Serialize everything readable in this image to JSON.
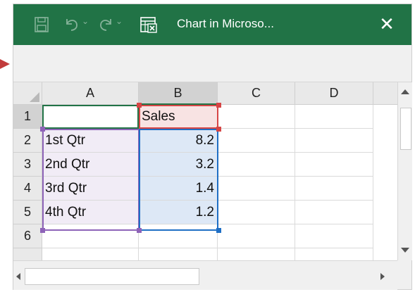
{
  "titlebar": {
    "title": "Chart in Microso...",
    "close_glyph": "✕",
    "undo_dropdown_glyph": "⌄",
    "redo_dropdown_glyph": "⌄",
    "icons": [
      "save-icon",
      "undo-icon",
      "redo-icon",
      "excel-sheet-icon",
      "close-icon"
    ]
  },
  "sheet": {
    "columns": [
      "A",
      "B",
      "C",
      "D"
    ],
    "rows": [
      "1",
      "2",
      "3",
      "4",
      "5",
      "6"
    ],
    "cells": {
      "A1": "",
      "B1": "Sales",
      "A2": "1st Qtr",
      "B2": "8.2",
      "A3": "2nd Qtr",
      "B3": "3.2",
      "A4": "3rd Qtr",
      "B4": "1.4",
      "A5": "4th Qtr",
      "B5": "1.2"
    }
  },
  "colors": {
    "titlebar": "#217346",
    "series_range": "#1f6fc5",
    "category_range": "#8e63b8",
    "series_name_range": "#d64545",
    "selected_header_underline": "#217346"
  }
}
